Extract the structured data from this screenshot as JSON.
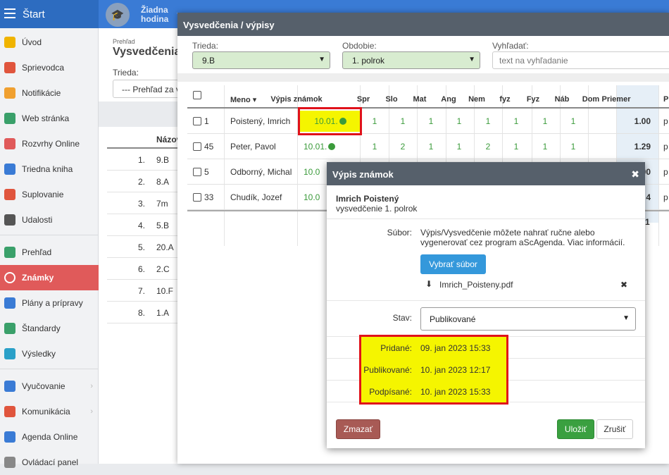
{
  "topbar": {
    "start_label": "Štart",
    "lesson_line1": "Žiadna",
    "lesson_line2": "hodina"
  },
  "sidebar": {
    "items": [
      {
        "label": "Úvod",
        "icon": "star-icon",
        "color": "#f0b400"
      },
      {
        "label": "Sprievodca",
        "icon": "magic-wand-icon",
        "color": "#e0553d"
      },
      {
        "label": "Notifikácie",
        "icon": "envelope-icon",
        "color": "#f0a030"
      },
      {
        "label": "Web stránka",
        "icon": "home-icon",
        "color": "#3aa06a"
      },
      {
        "label": "Rozvrhy Online",
        "icon": "timetable-icon",
        "color": "#e05a5a"
      },
      {
        "label": "Triedna kniha",
        "icon": "book-icon",
        "color": "#3a7bd5"
      },
      {
        "label": "Suplovanie",
        "icon": "person-icon",
        "color": "#e0553d"
      },
      {
        "label": "Udalosti",
        "icon": "calendar-icon",
        "color": "#555555"
      },
      {
        "label": "Prehľad",
        "icon": "check-circle-icon",
        "color": "#3aa06a"
      },
      {
        "label": "Známky",
        "icon": "grade-icon",
        "color": "#ffffff"
      },
      {
        "label": "Plány a prípravy",
        "icon": "briefcase-icon",
        "color": "#3a7bd5"
      },
      {
        "label": "Štandardy",
        "icon": "shield-check-icon",
        "color": "#3aa06a"
      },
      {
        "label": "Výsledky",
        "icon": "bar-chart-icon",
        "color": "#2aa0c8"
      },
      {
        "label": "Vyučovanie",
        "icon": "open-book-icon",
        "color": "#3a7bd5"
      },
      {
        "label": "Komunikácia",
        "icon": "chat-icon",
        "color": "#e0553d"
      },
      {
        "label": "Agenda Online",
        "icon": "pen-icon",
        "color": "#3a7bd5"
      },
      {
        "label": "Ovládací panel",
        "icon": "gear-icon",
        "color": "#888888"
      }
    ]
  },
  "bgpage": {
    "crumb": "Prehľad",
    "title": "Vysvedčenia",
    "trieda_label": "Trieda:",
    "trieda_value": "--- Prehľad za v",
    "col_header": "Názov",
    "rows": [
      {
        "n": "1.",
        "c": "9.B"
      },
      {
        "n": "2.",
        "c": "8.A"
      },
      {
        "n": "3.",
        "c": "7m"
      },
      {
        "n": "4.",
        "c": "5.B"
      },
      {
        "n": "5.",
        "c": "20.A"
      },
      {
        "n": "6.",
        "c": "2.C"
      },
      {
        "n": "7.",
        "c": "10.F"
      },
      {
        "n": "8.",
        "c": "1.A"
      }
    ]
  },
  "panel": {
    "title": "Vysvedčenia / výpisy",
    "trieda_label": "Trieda:",
    "trieda_value": "9.B",
    "obdobie_label": "Obdobie:",
    "obdobie_value": "1. polrok",
    "search_label": "Vyhľadať:",
    "search_placeholder": "text na vyhľadanie"
  },
  "grid": {
    "headers": {
      "meno": "Meno ▾",
      "vypis": "Výpis známok",
      "spr": "Spr",
      "slo": "Slo",
      "mat": "Mat",
      "ang": "Ang",
      "nem": "Nem",
      "fyz1": "fyz",
      "fyz2": "Fyz",
      "nab": "Náb",
      "dom": "Dom",
      "priemer": "Priemer",
      "extra": "P"
    },
    "rows": [
      {
        "num": "1",
        "name": "Poistený, Imrich",
        "vypis": "10.01.",
        "grades": [
          "1",
          "1",
          "1",
          "1",
          "1",
          "1",
          "1",
          "1"
        ],
        "avg": "1.00",
        "extra": "p"
      },
      {
        "num": "45",
        "name": "Peter, Pavol",
        "vypis": "10.01.",
        "grades": [
          "1",
          "2",
          "1",
          "1",
          "2",
          "1",
          "1",
          "1"
        ],
        "avg": "1.29",
        "extra": "p"
      },
      {
        "num": "5",
        "name": "Odborný, Michal",
        "vypis": "10.0",
        "grades": [
          "",
          "",
          "",
          "",
          "",
          "",
          "",
          ""
        ],
        "avg": "00",
        "extra": "p"
      },
      {
        "num": "33",
        "name": "Chudík, Jozef",
        "vypis": "10.0",
        "grades": [
          "",
          "",
          "",
          "",
          "",
          "",
          "",
          ""
        ],
        "avg": "4",
        "extra": "p"
      }
    ],
    "footer_avg": "1"
  },
  "modal": {
    "title": "Výpis známok",
    "student": "Imrich Poistený",
    "subtitle": "vysvedčenie 1. polrok",
    "subor_label": "Súbor:",
    "subor_text_1": "Výpis/Vysvedčenie môžete nahrať ručne alebo",
    "subor_text_2": "vygenerovať cez program aScAgenda. Viac informácií.",
    "choose_file": "Vybrať súbor",
    "file_name": "Imrich_Poisteny.pdf",
    "stav_label": "Stav:",
    "stav_value": "Publikované",
    "pridane_label": "Pridané:",
    "pridane_value": "09. jan 2023 15:33",
    "publikovane_label": "Publikované:",
    "publikovane_value": "10. jan 2023 12:17",
    "podpisane_label": "Podpísané:",
    "podpisane_value": "10. jan 2023 15:33",
    "delete_label": "Zmazať",
    "save_label": "Uložiť",
    "cancel_label": "Zrušiť"
  },
  "colors": {
    "topbar": "#3a7bd5",
    "active": "#e05a5a",
    "header": "#56606b",
    "grade": "#3b9b3b",
    "highlight": "#e0121a",
    "primary": "#3498db",
    "save": "#3aa040",
    "delete": "#a85a55"
  }
}
